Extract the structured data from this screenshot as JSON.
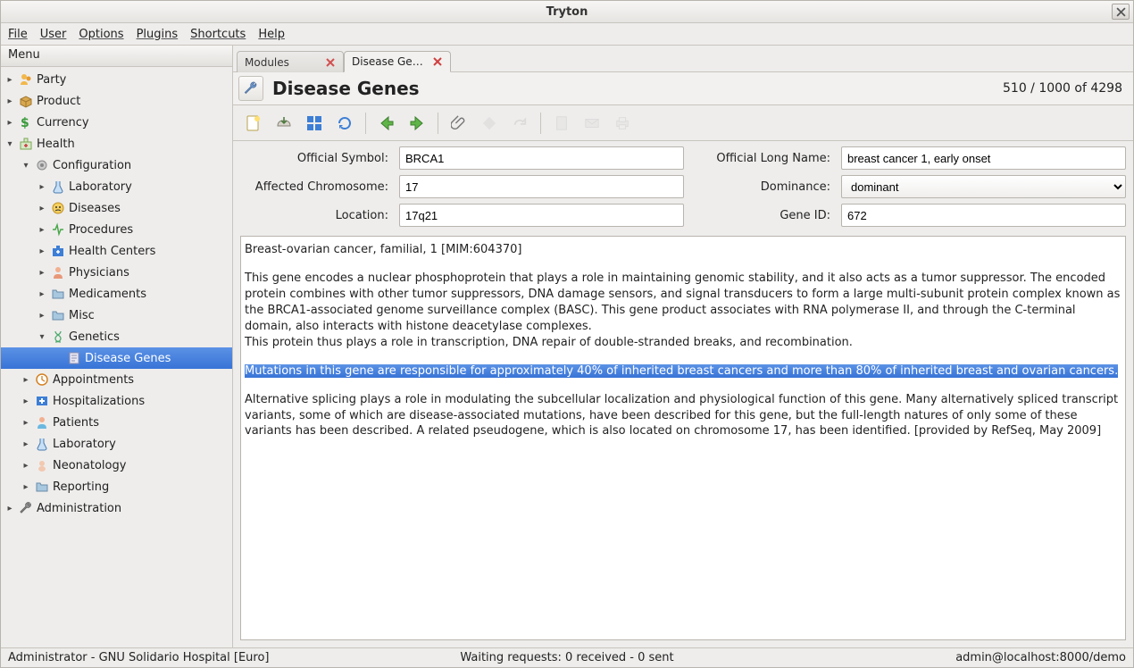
{
  "window": {
    "title": "Tryton"
  },
  "menubar": [
    "File",
    "User",
    "Options",
    "Plugins",
    "Shortcuts",
    "Help"
  ],
  "sidebar": {
    "header": "Menu",
    "items": [
      {
        "label": "Party",
        "expand": "closed",
        "indent": 0,
        "icon": "party"
      },
      {
        "label": "Product",
        "expand": "closed",
        "indent": 0,
        "icon": "product"
      },
      {
        "label": "Currency",
        "expand": "closed",
        "indent": 0,
        "icon": "currency"
      },
      {
        "label": "Health",
        "expand": "open",
        "indent": 0,
        "icon": "health"
      },
      {
        "label": "Configuration",
        "expand": "open",
        "indent": 1,
        "icon": "config"
      },
      {
        "label": "Laboratory",
        "expand": "closed",
        "indent": 2,
        "icon": "lab"
      },
      {
        "label": "Diseases",
        "expand": "closed",
        "indent": 2,
        "icon": "diseases"
      },
      {
        "label": "Procedures",
        "expand": "closed",
        "indent": 2,
        "icon": "procedures"
      },
      {
        "label": "Health Centers",
        "expand": "closed",
        "indent": 2,
        "icon": "healthcenters"
      },
      {
        "label": "Physicians",
        "expand": "closed",
        "indent": 2,
        "icon": "physicians"
      },
      {
        "label": "Medicaments",
        "expand": "closed",
        "indent": 2,
        "icon": "folder"
      },
      {
        "label": "Misc",
        "expand": "closed",
        "indent": 2,
        "icon": "folder"
      },
      {
        "label": "Genetics",
        "expand": "open",
        "indent": 2,
        "icon": "genetics"
      },
      {
        "label": "Disease Genes",
        "expand": "none",
        "indent": 3,
        "icon": "doc",
        "selected": true
      },
      {
        "label": "Appointments",
        "expand": "closed",
        "indent": 1,
        "icon": "appointments"
      },
      {
        "label": "Hospitalizations",
        "expand": "closed",
        "indent": 1,
        "icon": "hospitalizations"
      },
      {
        "label": "Patients",
        "expand": "closed",
        "indent": 1,
        "icon": "patients"
      },
      {
        "label": "Laboratory",
        "expand": "closed",
        "indent": 1,
        "icon": "lab2"
      },
      {
        "label": "Neonatology",
        "expand": "closed",
        "indent": 1,
        "icon": "neonatology"
      },
      {
        "label": "Reporting",
        "expand": "closed",
        "indent": 1,
        "icon": "folder"
      },
      {
        "label": "Administration",
        "expand": "closed",
        "indent": 0,
        "icon": "admin"
      }
    ]
  },
  "tabs": [
    {
      "label": "Modules",
      "active": false
    },
    {
      "label": "Disease Ge…",
      "active": true
    }
  ],
  "header": {
    "title": "Disease Genes",
    "count": "510 / 1000 of 4298"
  },
  "form": {
    "official_symbol_label": "Official Symbol:",
    "official_symbol": "BRCA1",
    "official_long_name_label": "Official Long Name:",
    "official_long_name": "breast cancer 1, early onset",
    "affected_chr_label": "Affected Chromosome:",
    "affected_chr": "17",
    "dominance_label": "Dominance:",
    "dominance": "dominant",
    "location_label": "Location:",
    "location": "17q21",
    "gene_id_label": "Gene ID:",
    "gene_id": "672"
  },
  "description": {
    "p1": "Breast-ovarian cancer, familial, 1 [MIM:604370]",
    "p2": "This gene encodes a nuclear phosphoprotein that plays a role in maintaining genomic stability, and it also acts as a tumor suppressor. The encoded protein combines with other tumor suppressors, DNA damage sensors, and signal transducers to form a large multi-subunit protein complex known as the BRCA1-associated genome surveillance complex (BASC). This gene product associates with RNA polymerase II, and through the C-terminal domain, also interacts with histone deacetylase complexes.",
    "p3": "This protein thus plays a role in transcription, DNA repair of double-stranded breaks, and recombination.",
    "p4": "Mutations in this gene are responsible for approximately 40% of inherited breast cancers and more than 80% of inherited breast and ovarian cancers.",
    "p5": "Alternative splicing plays a role in modulating the subcellular localization and physiological function of this gene. Many alternatively spliced transcript variants, some of which are disease-associated mutations, have been described for this gene, but the full-length natures of only some of these variants has been described. A related pseudogene, which is also located on chromosome 17, has been identified. [provided by RefSeq, May 2009]"
  },
  "statusbar": {
    "left": "Administrator - GNU Solidario Hospital [Euro]",
    "center": "Waiting requests: 0 received - 0 sent",
    "right": "admin@localhost:8000/demo"
  }
}
